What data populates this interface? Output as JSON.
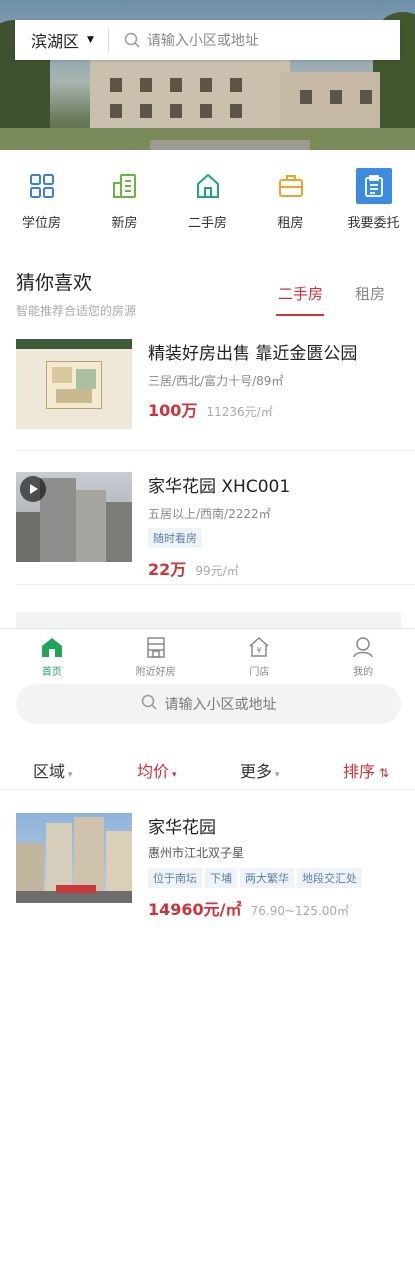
{
  "header": {
    "district": "滨湖区",
    "search_placeholder": "请输入小区或地址"
  },
  "quick_nav": [
    {
      "label": "学位房",
      "icon": "grid-icon"
    },
    {
      "label": "新房",
      "icon": "building-icon"
    },
    {
      "label": "二手房",
      "icon": "house-icon"
    },
    {
      "label": "租房",
      "icon": "suitcase-icon"
    },
    {
      "label": "我要委托",
      "icon": "clipboard-icon"
    }
  ],
  "recommend": {
    "title": "猜你喜欢",
    "subtitle": "智能推荐合适您的房源",
    "tabs": [
      "二手房",
      "租房"
    ],
    "active_tab": "二手房"
  },
  "listings": [
    {
      "title": "精装好房出售 靠近金匮公园",
      "meta": "三居/西北/富力十号/89㎡",
      "price": "100万",
      "unit_price": "11236元/㎡"
    },
    {
      "title": "家华花园 XHC001",
      "meta": "五居以上/西南/2222㎡",
      "tag": "随时看房",
      "price": "22万",
      "unit_price": "99元/㎡"
    }
  ],
  "bottom_nav": [
    {
      "label": "首页",
      "icon": "home-icon",
      "active": true
    },
    {
      "label": "附近好房",
      "icon": "nearby-building-icon",
      "active": false
    },
    {
      "label": "门店",
      "icon": "store-icon",
      "active": false
    },
    {
      "label": "我的",
      "icon": "user-icon",
      "active": false
    }
  ],
  "search2": {
    "placeholder": "请输入小区或地址"
  },
  "filters": {
    "area": "区域",
    "avg_price": "均价",
    "more": "更多",
    "sort": "排序"
  },
  "community": {
    "name": "家华花园",
    "address": "惠州市江北双子星",
    "tags": [
      "位于南坛",
      "下埔",
      "两大繁华",
      "地段交汇处"
    ],
    "price": "14960元/㎡",
    "area_range": "76.90~125.00㎡"
  },
  "colors": {
    "accent_red": "#d0313a",
    "nav_green": "#21a35b",
    "tag_blue": "#5c7fa8"
  }
}
